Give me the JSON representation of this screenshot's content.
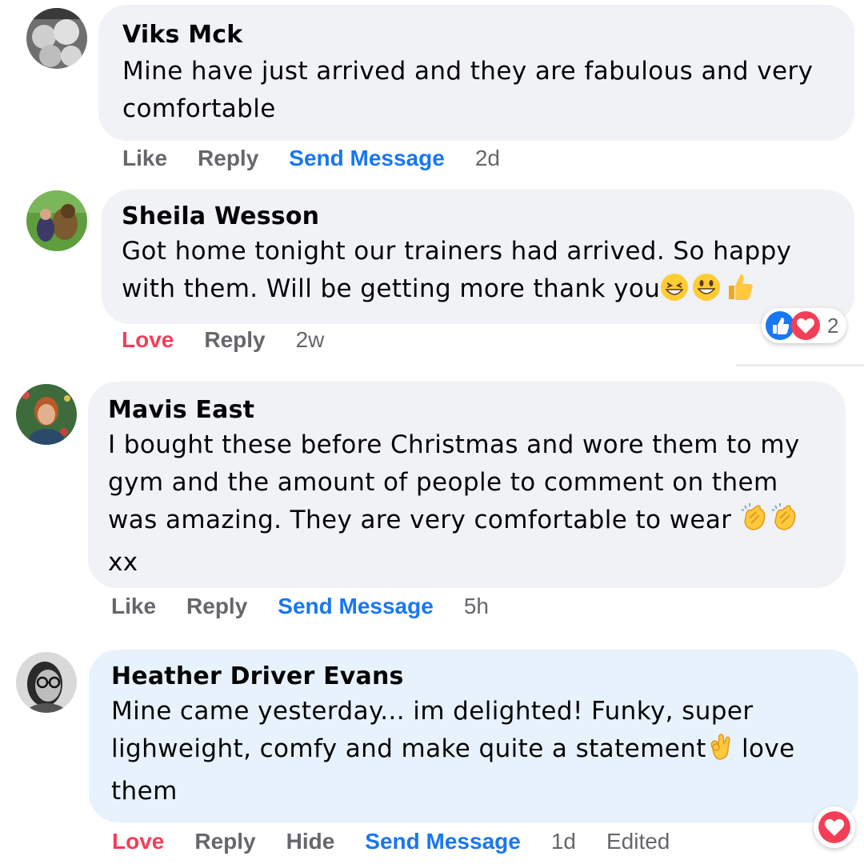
{
  "comments": [
    {
      "author": "Viks Mck",
      "text_lines": [
        "Mine have just arrived and they are fabulous and very",
        "comfortable"
      ],
      "actions": {
        "react": "Like",
        "reply": "Reply",
        "message": "Send Message",
        "time": "2d"
      }
    },
    {
      "author": "Sheila Wesson",
      "text_lines": [
        "Got home tonight our trainers had arrived. So happy",
        "with them. Will be getting more thank you"
      ],
      "emojis": [
        "grinning-squinting-face",
        "grinning-face",
        "thumbs-up"
      ],
      "actions": {
        "react": "Love",
        "reply": "Reply",
        "time": "2w"
      },
      "reactions": {
        "icons": [
          "like-reaction",
          "love-reaction"
        ],
        "count": "2"
      }
    },
    {
      "author": "Mavis East",
      "text_lines": [
        "I bought these before Christmas and wore them to my",
        "gym and the amount of people to comment on them",
        "was amazing. They are very comfortable to wear",
        "xx"
      ],
      "emojis": [
        "clapping-hands",
        "clapping-hands"
      ],
      "actions": {
        "react": "Like",
        "reply": "Reply",
        "message": "Send Message",
        "time": "5h"
      }
    },
    {
      "author": "Heather Driver Evans",
      "text_lines": [
        "Mine came yesterday... im delighted! Funky, super",
        "lighweight, comfy and make quite a statement",
        "love",
        "them"
      ],
      "emojis": [
        "ok-hand"
      ],
      "actions": {
        "react": "Love",
        "reply": "Reply",
        "hide": "Hide",
        "message": "Send Message",
        "time": "1d",
        "edited": "Edited"
      },
      "reactions": {
        "icons": [
          "love-reaction"
        ]
      }
    }
  ],
  "colors": {
    "bubble": "#f0f2f5",
    "bubble_highlight": "#e8f2fd",
    "link_blue": "#1877f2",
    "love_red": "#f33e58",
    "meta_gray": "#65676b"
  }
}
